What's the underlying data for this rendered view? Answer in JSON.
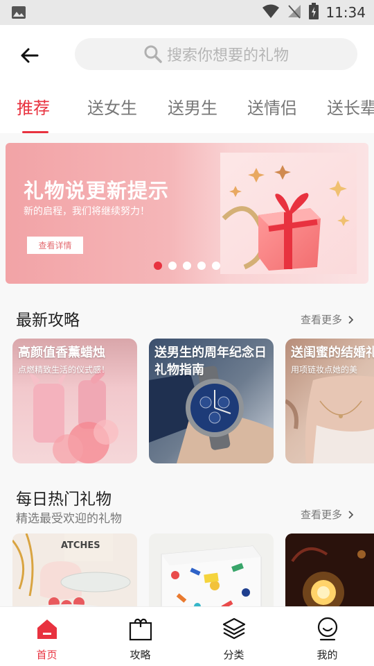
{
  "status_bar": {
    "time": "11:34"
  },
  "header": {
    "search_placeholder": "搜索你想要的礼物"
  },
  "tabs": [
    {
      "label": "推荐"
    },
    {
      "label": "送女生"
    },
    {
      "label": "送男生"
    },
    {
      "label": "送情侣"
    },
    {
      "label": "送长辈"
    }
  ],
  "active_tab": "推荐",
  "banner": {
    "title": "礼物说更新提示",
    "subtitle": "新的启程，我们将继续努力！",
    "button_label": "查看详情",
    "dot_count": 5,
    "active_dot": 1
  },
  "guides": {
    "title": "最新攻略",
    "more_label": "查看更多",
    "cards": [
      {
        "title": "高颜值香薰蜡烛",
        "subtitle": "点燃精致生活的仪式感！"
      },
      {
        "title": "送男生的周年纪念日礼物指南",
        "subtitle": ""
      },
      {
        "title": "送闺蜜的结婚礼",
        "subtitle": "用项链妆点她的美"
      }
    ]
  },
  "hot_gifts": {
    "title": "每日热门礼物",
    "subtitle": "精选最受欢迎的礼物",
    "more_label": "查看更多",
    "card_text": "ATCHES"
  },
  "bottom_nav": [
    {
      "label": "首页",
      "icon": "home-icon"
    },
    {
      "label": "攻略",
      "icon": "strategy-icon"
    },
    {
      "label": "分类",
      "icon": "category-icon"
    },
    {
      "label": "我的",
      "icon": "profile-icon"
    }
  ],
  "colors": {
    "accent": "#e8323f",
    "banner_pink": "#f2a3a6"
  }
}
